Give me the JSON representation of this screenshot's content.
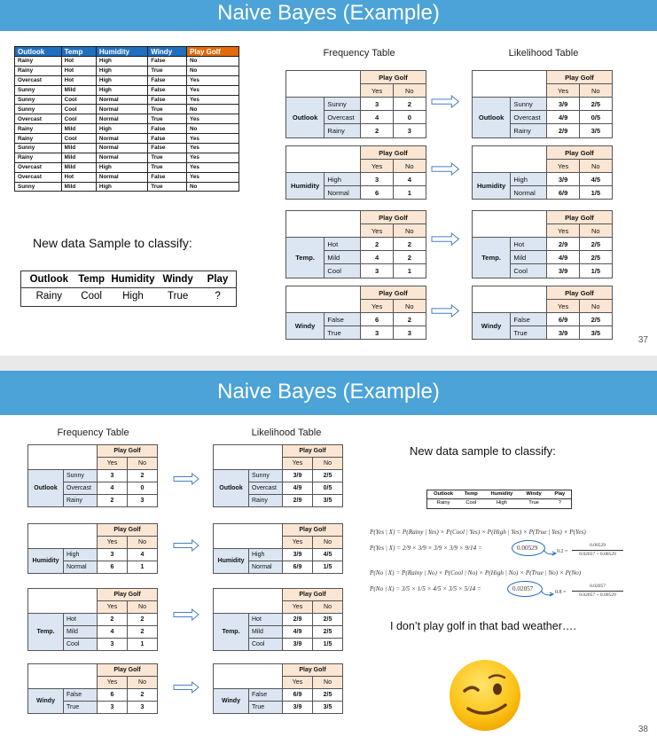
{
  "slide1": {
    "title": "Naive Bayes (Example)",
    "page": "37",
    "golf_table": {
      "headers": [
        "Outlook",
        "Temp",
        "Humidity",
        "Windy",
        "Play Golf"
      ],
      "rows": [
        [
          "Rainy",
          "Hot",
          "High",
          "False",
          "No"
        ],
        [
          "Rainy",
          "Hot",
          "High",
          "True",
          "No"
        ],
        [
          "Overcast",
          "Hot",
          "High",
          "False",
          "Yes"
        ],
        [
          "Sunny",
          "Mild",
          "High",
          "False",
          "Yes"
        ],
        [
          "Sunny",
          "Cool",
          "Normal",
          "False",
          "Yes"
        ],
        [
          "Sunny",
          "Cool",
          "Normal",
          "True",
          "No"
        ],
        [
          "Overcast",
          "Cool",
          "Normal",
          "True",
          "Yes"
        ],
        [
          "Rainy",
          "Mild",
          "High",
          "False",
          "No"
        ],
        [
          "Rainy",
          "Cool",
          "Normal",
          "False",
          "Yes"
        ],
        [
          "Sunny",
          "Mild",
          "Normal",
          "False",
          "Yes"
        ],
        [
          "Rainy",
          "Mild",
          "Normal",
          "True",
          "Yes"
        ],
        [
          "Overcast",
          "Mild",
          "High",
          "True",
          "Yes"
        ],
        [
          "Overcast",
          "Hot",
          "Normal",
          "False",
          "Yes"
        ],
        [
          "Sunny",
          "Mild",
          "High",
          "True",
          "No"
        ]
      ]
    },
    "new_sample_label": "New data Sample to classify:",
    "sample": {
      "headers": [
        "Outlook",
        "Temp",
        "Humidity",
        "Windy",
        "Play"
      ],
      "values": [
        "Rainy",
        "Cool",
        "High",
        "True",
        "?"
      ]
    },
    "freq_caption": "Frequency Table",
    "like_caption": "Likelihood Table"
  },
  "tables": {
    "play_golf": "Play Golf",
    "yes": "Yes",
    "no": "No",
    "freq": [
      {
        "attr": "Outlook",
        "rows": [
          [
            "Sunny",
            "3",
            "2"
          ],
          [
            "Overcast",
            "4",
            "0"
          ],
          [
            "Rainy",
            "2",
            "3"
          ]
        ]
      },
      {
        "attr": "Humidity",
        "rows": [
          [
            "High",
            "3",
            "4"
          ],
          [
            "Normal",
            "6",
            "1"
          ]
        ]
      },
      {
        "attr": "Temp.",
        "rows": [
          [
            "Hot",
            "2",
            "2"
          ],
          [
            "Mild",
            "4",
            "2"
          ],
          [
            "Cool",
            "3",
            "1"
          ]
        ]
      },
      {
        "attr": "Windy",
        "rows": [
          [
            "False",
            "6",
            "2"
          ],
          [
            "True",
            "3",
            "3"
          ]
        ]
      }
    ],
    "like": [
      {
        "attr": "Outlook",
        "rows": [
          [
            "Sunny",
            "3/9",
            "2/5"
          ],
          [
            "Overcast",
            "4/9",
            "0/5"
          ],
          [
            "Rainy",
            "2/9",
            "3/5"
          ]
        ]
      },
      {
        "attr": "Humidity",
        "rows": [
          [
            "High",
            "3/9",
            "4/5"
          ],
          [
            "Normal",
            "6/9",
            "1/5"
          ]
        ]
      },
      {
        "attr": "Temp.",
        "rows": [
          [
            "Hot",
            "2/9",
            "2/5"
          ],
          [
            "Mild",
            "4/9",
            "2/5"
          ],
          [
            "Cool",
            "3/9",
            "1/5"
          ]
        ]
      },
      {
        "attr": "Windy",
        "rows": [
          [
            "False",
            "6/9",
            "2/5"
          ],
          [
            "True",
            "3/9",
            "3/5"
          ]
        ]
      }
    ]
  },
  "slide2": {
    "title": "Naive Bayes (Example)",
    "page": "38",
    "freq_caption": "Frequency Table",
    "like_caption": "Likelihood Table",
    "new_sample_label": "New data sample to classify:",
    "sample": {
      "headers": [
        "Outlook",
        "Temp",
        "Humidity",
        "Windy",
        "Play"
      ],
      "values": [
        "Rainy",
        "Cool",
        "High",
        "True",
        "?"
      ]
    },
    "formulas": {
      "yes_def": "P(Yes | X) = P(Rainy | Yes) × P(Cool | Yes) × P(High | Yes) × P(True | Yes) × P(Yes)",
      "yes_calc": "P(Yes | X) = 2/9 × 3/9 × 3/9 × 3/9 × 9/14 =",
      "yes_value": "0.00529",
      "yes_norm": "0.2 =",
      "yes_num": "0.00529",
      "yes_den": "0.02057 + 0.00529",
      "no_def": "P(No | X) = P(Rainy | No) × P(Cool | No) × P(High | No) × P(True | No) × P(No)",
      "no_calc": "P(No | X) = 3/5 × 1/5 × 4/5 × 3/5 × 5/14 =",
      "no_value": "0.02057",
      "no_norm": "0.8 =",
      "no_num": "0.02057",
      "no_den": "0.02057 + 0.00529"
    },
    "conclusion": "I don’t play golf in that bad weather….",
    "emoji_icon": "winking-face-icon"
  }
}
